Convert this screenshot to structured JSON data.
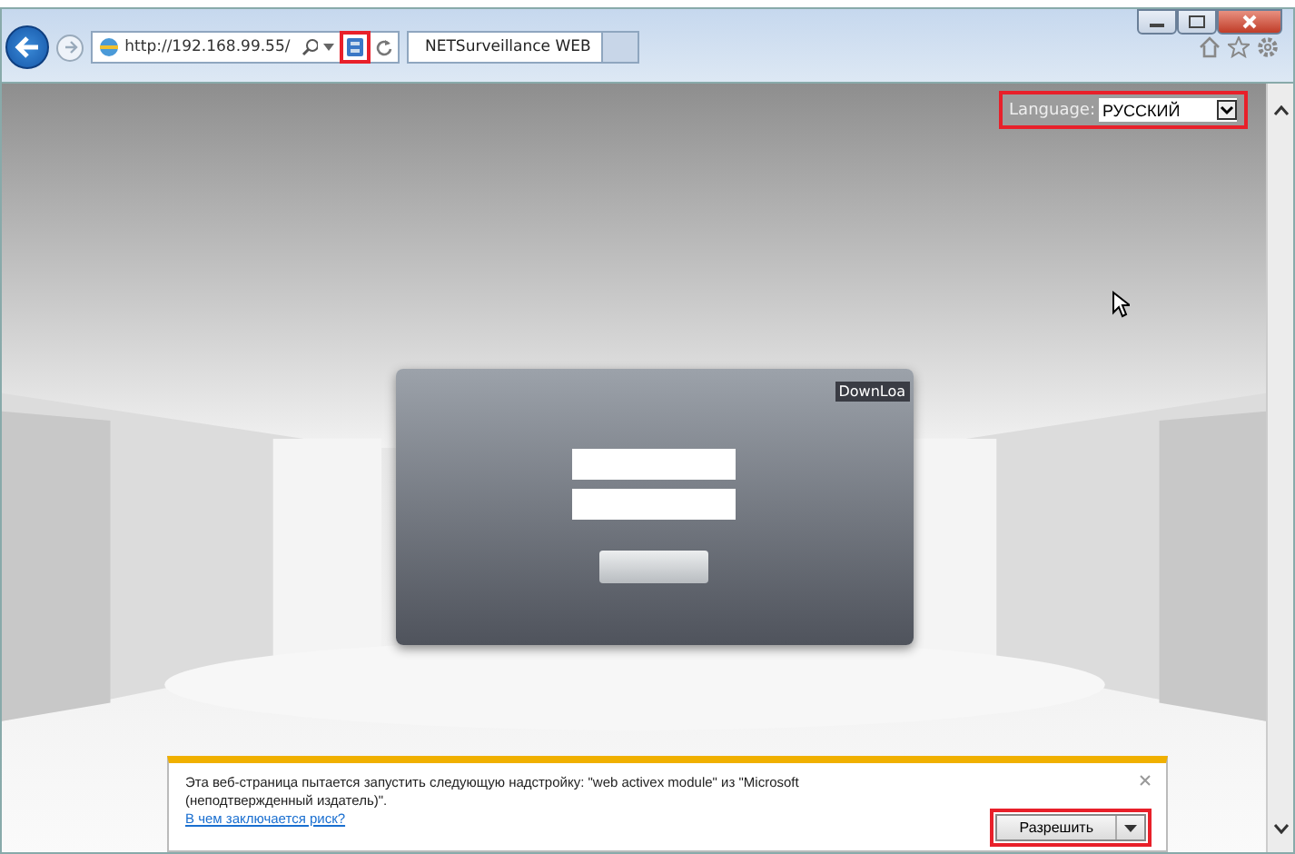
{
  "address_bar": {
    "url": "http://192.168.99.55/"
  },
  "tabs": [
    {
      "title": "NETSurveillance WEB",
      "selected": true
    }
  ],
  "page": {
    "language_label": "Language:",
    "language_value": "РУССКИЙ",
    "download_button": "DownLoa"
  },
  "notification": {
    "message": "Эта веб-страница пытается запустить следующую надстройку: \"web activex  module\" из \"Microsoft (неподтвержденный издатель)\".",
    "link": "В чем заключается риск?",
    "button": "Разрешить"
  }
}
